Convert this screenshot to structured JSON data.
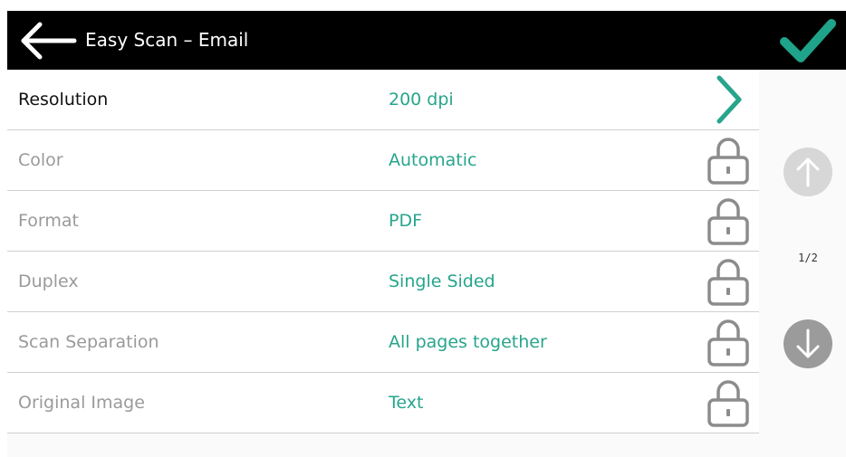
{
  "header": {
    "title": "Easy Scan – Email",
    "back_icon": "arrow-left-icon",
    "confirm_icon": "checkmark-icon"
  },
  "settings": [
    {
      "label": "Resolution",
      "value": "200 dpi",
      "state": "editable",
      "icon": "chevron-right-icon"
    },
    {
      "label": "Color",
      "value": "Automatic",
      "state": "locked",
      "icon": "lock-icon"
    },
    {
      "label": "Format",
      "value": "PDF",
      "state": "locked",
      "icon": "lock-icon"
    },
    {
      "label": "Duplex",
      "value": "Single Sided",
      "state": "locked",
      "icon": "lock-icon"
    },
    {
      "label": "Scan Separation",
      "value": "All pages together",
      "state": "locked",
      "icon": "lock-icon"
    },
    {
      "label": "Original Image",
      "value": "Text",
      "state": "locked",
      "icon": "lock-icon"
    }
  ],
  "pagination": {
    "page_label": "1/2",
    "up_icon": "arrow-up-icon",
    "down_icon": "arrow-down-icon",
    "up_enabled": false,
    "down_enabled": true
  },
  "colors": {
    "header_bg": "#000000",
    "accent": "#27a58c",
    "confirm": "#1fa38a",
    "locked_text": "#9a9a9a"
  }
}
